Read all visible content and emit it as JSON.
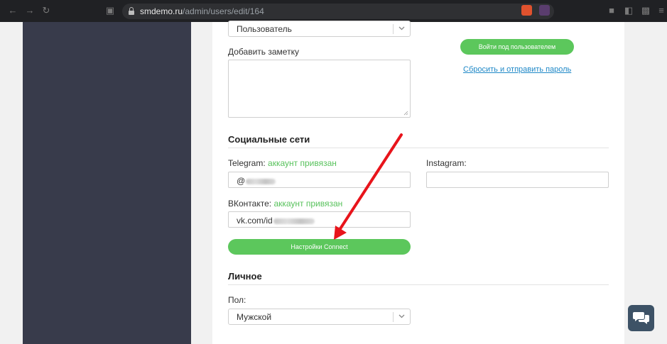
{
  "browser": {
    "url_host": "smdemo.ru",
    "url_path": "/admin/users/edit/164"
  },
  "form": {
    "role_select_value": "Пользователь",
    "note_label": "Добавить заметку",
    "login_as_button": "Войти под пользователем",
    "reset_password_link": "Сбросить и отправить пароль",
    "social": {
      "title": "Социальные сети",
      "telegram_label": "Telegram:",
      "telegram_status": "аккаунт привязан",
      "telegram_value_prefix": "@",
      "instagram_label": "Instagram:",
      "vk_label": "ВКонтакте:",
      "vk_status": "аккаунт привязан",
      "vk_value_prefix": "vk.com/id",
      "connect_button": "Настройки Connect"
    },
    "personal": {
      "title": "Личное",
      "gender_label": "Пол:",
      "gender_value": "Мужской"
    }
  },
  "colors": {
    "accent_green": "#5cc75c",
    "status_green": "#58c25c",
    "link_blue": "#1e88c7",
    "sidebar": "#383b4b",
    "annotation_arrow": "#e8141b"
  }
}
